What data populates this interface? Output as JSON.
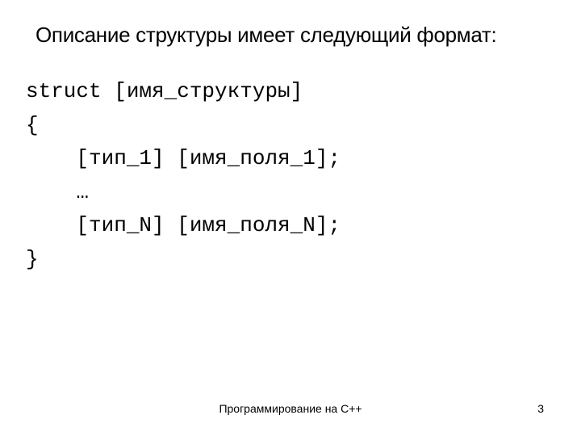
{
  "title": "Описание структуры имеет следующий формат:",
  "code": {
    "line1": "struct [имя_структуры]",
    "line2": "{",
    "line3": "    [тип_1] [имя_поля_1];",
    "line4": "    …",
    "line5": "    [тип_N] [имя_поля_N];",
    "line6": "}"
  },
  "footer": "Программирование на С++",
  "page_number": "3"
}
